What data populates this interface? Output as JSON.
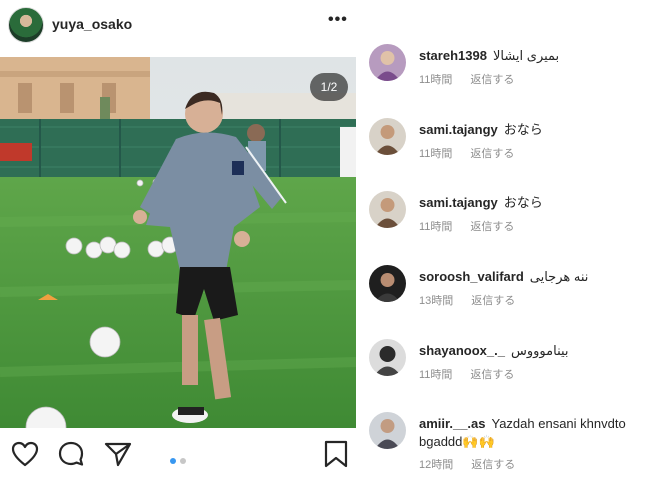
{
  "post": {
    "username": "yuya_osako",
    "counter": "1/2",
    "more_label": "•••"
  },
  "comments": [
    {
      "username": "stareh1398",
      "text": "بمیری ایشالا",
      "time": "11時間",
      "reply": "返信する",
      "avatar_color": "#7a4c8c"
    },
    {
      "username": "sami.tajangy",
      "text": "おなら",
      "time": "11時間",
      "reply": "返信する",
      "avatar_color": "#6b4f3a"
    },
    {
      "username": "sami.tajangy",
      "text": "おなら",
      "time": "11時間",
      "reply": "返信する",
      "avatar_color": "#6b4f3a"
    },
    {
      "username": "soroosh_valifard",
      "text": "ننه هرجایی",
      "time": "13時間",
      "reply": "返信する",
      "avatar_color": "#3a3a3a"
    },
    {
      "username": "shayanoox_._",
      "text": "بیناموووس",
      "time": "11時間",
      "reply": "返信する",
      "avatar_color": "#2b2b2b"
    },
    {
      "username": "amiir.__.as",
      "text": "Yazdah ensani khnvdto bgaddd🙌🙌",
      "time": "12時間",
      "reply": "返信する",
      "avatar_color": "#4a4a55"
    }
  ],
  "colors": {
    "text": "#262626",
    "meta": "#8e8e8e",
    "dot_active": "#3897f0",
    "dot_inactive": "#c7c7c7"
  },
  "icons": [
    "heart-icon",
    "comment-icon",
    "share-icon",
    "bookmark-icon"
  ]
}
